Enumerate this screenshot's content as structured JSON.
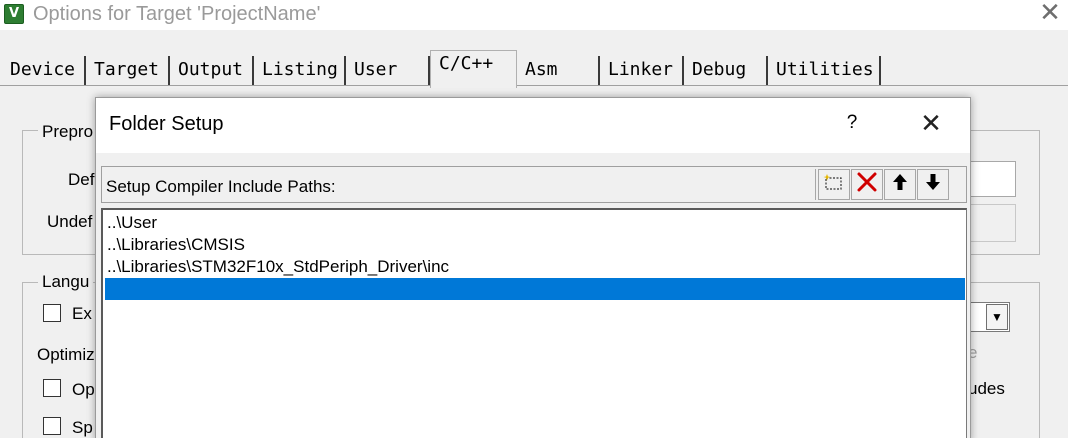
{
  "window": {
    "title": "Options for Target 'ProjectName'",
    "close_glyph": "✕"
  },
  "tabs": [
    {
      "label": "Device"
    },
    {
      "label": "Target"
    },
    {
      "label": "Output"
    },
    {
      "label": "Listing"
    },
    {
      "label": "User"
    },
    {
      "label": "C/C++",
      "active": true
    },
    {
      "label": "Asm"
    },
    {
      "label": "Linker"
    },
    {
      "label": "Debug"
    },
    {
      "label": "Utilities"
    }
  ],
  "background": {
    "preprocessor_group_label": "Prepro",
    "define_label": "Def",
    "undefine_label": "Undef",
    "language_group_label": "Langu",
    "execute_only_label": "Ex",
    "optimization_label": "Optimiz",
    "option1_label": "Op",
    "option2_label": "Sp",
    "warnings_fragment": "e",
    "includes_fragment": "udes",
    "dropdown_glyph": "▼"
  },
  "dialog": {
    "title": "Folder Setup",
    "help_label": "?",
    "close_glyph": "✕",
    "header_label": "Setup Compiler Include Paths:",
    "toolbar": {
      "new_icon": "new-folder-icon",
      "delete_icon": "delete-icon",
      "move_up_icon": "arrow-up-icon",
      "move_down_icon": "arrow-down-icon"
    },
    "paths": [
      {
        "text": "..\\User"
      },
      {
        "text": "..\\Libraries\\CMSIS"
      },
      {
        "text": "..\\Libraries\\STM32F10x_StdPeriph_Driver\\inc"
      },
      {
        "text": "",
        "selected": true
      }
    ],
    "selection_color": "#0078d7",
    "delete_color": "#d00000"
  }
}
